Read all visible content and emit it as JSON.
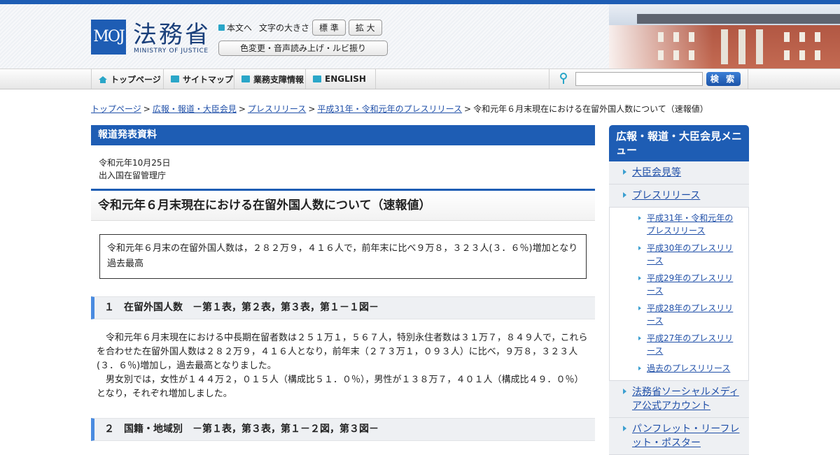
{
  "header": {
    "logo_mark": "MOJ",
    "logo_title": "法務省",
    "logo_subtitle": "MINISTRY OF JUSTICE",
    "skip_link": "本文へ",
    "font_size_label": "文字の大きさ",
    "font_standard": "標 準",
    "font_large": "拡 大",
    "accessibility": "色変更・音声読み上げ・ルビ振り"
  },
  "nav": {
    "items": [
      "トップページ",
      "サイトマップ",
      "業務支障情報",
      "ENGLISH"
    ],
    "search_placeholder": "",
    "search_button": "検 索"
  },
  "breadcrumb": {
    "links": [
      "トップページ",
      "広報・報道・大臣会見",
      "プレスリリース",
      "平成31年・令和元年のプレスリリース"
    ],
    "separator": ">",
    "current": "令和元年６月末現在における在留外国人数について（速報値）"
  },
  "main": {
    "section_label": "報道発表資料",
    "date": "令和元年10月25日",
    "agency": "出入国在留管理庁",
    "title": "令和元年６月末現在における在留外国人数について（速報値）",
    "summary": "令和元年６月末の在留外国人数は，２８２万９，４１６人で，前年末に比べ９万８，３２３人(３．６％)増加となり過去最高",
    "sections": [
      {
        "heading": "１　在留外国人数　－第１表，第２表，第３表，第１－１図－",
        "paragraphs": [
          "令和元年６月末現在における中長期在留者数は２５１万１，５６７人，特別永住者数は３１万７，８４９人で，これらを合わせた在留外国人数は２８２万９，４１６人となり，前年末（２７３万１，０９３人）に比べ，９万８，３２３人(３．６％)増加し，過去最高となりました。",
          "男女別では，女性が１４４万２，０１５人（構成比５１．０％），男性が１３８万７，４０１人（構成比４９．０％）となり，それぞれ増加しました。"
        ]
      },
      {
        "heading": "２　国籍・地域別　－第１表，第３表，第１－２図，第３図－"
      }
    ]
  },
  "sidebar": {
    "title": "広報・報道・大臣会見メニュー",
    "items": [
      "大臣会見等",
      "プレスリリース"
    ],
    "sub_items": [
      "平成31年・令和元年のプレスリリース",
      "平成30年のプレスリリース",
      "平成29年のプレスリリース",
      "平成28年のプレスリリース",
      "平成27年のプレスリリース",
      "過去のプレスリリース"
    ],
    "items_after": [
      "法務省ソーシャルメディア公式アカウント",
      "パンフレット・リーフレット・ポスター"
    ]
  },
  "colors": {
    "brand_blue": "#1e5db4",
    "accent_cyan": "#2aa6c8"
  }
}
